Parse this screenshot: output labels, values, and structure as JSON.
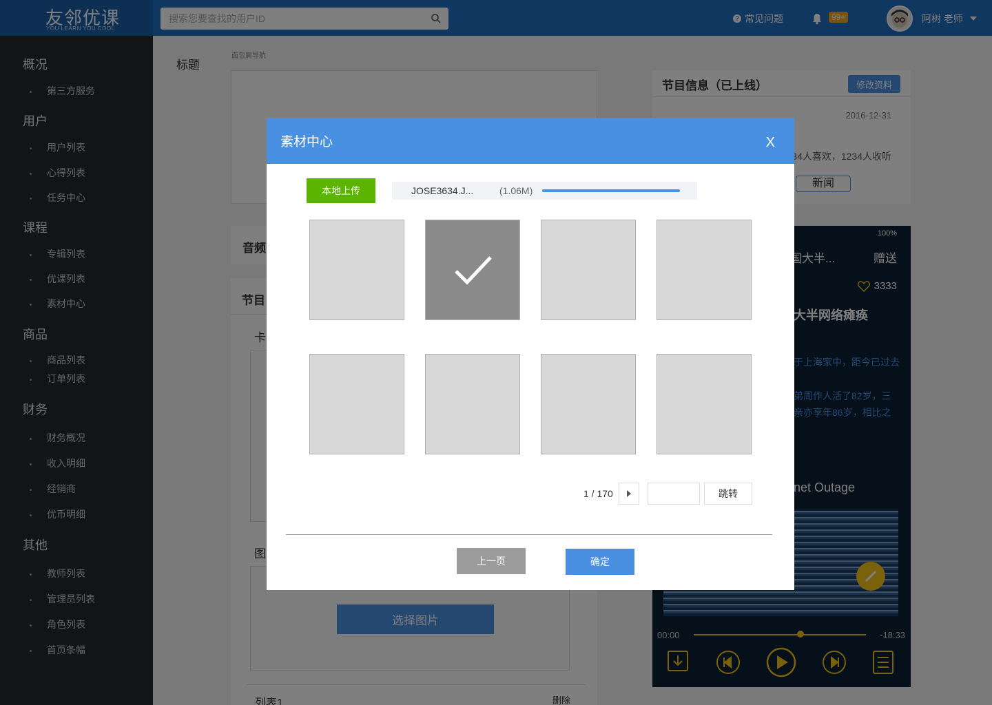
{
  "header": {
    "logo_main": "友邻优课",
    "logo_sub": "YOU LEARN YOU COOL",
    "search_placeholder": "搜索您要查找的用户ID",
    "faq": "常见问题",
    "badge": "99+",
    "user": "阿树 老师",
    "accent": "#1f6fc0"
  },
  "sidebar": {
    "sections": [
      {
        "label": "概况",
        "items": [
          "第三方服务"
        ]
      },
      {
        "label": "用户",
        "items": [
          "用户列表",
          "心得列表",
          "任务中心"
        ]
      },
      {
        "label": "课程",
        "items": [
          "专辑列表",
          "优课列表",
          "素材中心"
        ]
      },
      {
        "label": "商品",
        "items": [
          "商品列表",
          "订单列表"
        ]
      },
      {
        "label": "财务",
        "items": [
          "财务概况",
          "收入明细",
          "经销商",
          "优币明细"
        ]
      },
      {
        "label": "其他",
        "items": [
          "教师列表",
          "管理员列表",
          "角色列表",
          "首页条幅"
        ]
      }
    ]
  },
  "main": {
    "title_label": "标题",
    "breadcrumb": "面包屑导航",
    "audio_label": "音频",
    "program_label": "节目",
    "card_label": "卡",
    "picture_label": "图",
    "choose_image": "选择图片",
    "list_label": "列表1",
    "list_delete": "删除"
  },
  "info": {
    "title": "节目信息（已上线）",
    "edit": "修改资料",
    "date": "2016-12-31",
    "stats": "34人喜欢，1234人收听",
    "tag": "新闻"
  },
  "phone": {
    "battery": "100%",
    "title": "国大半...",
    "gift": "赠送",
    "likes": "3333",
    "headline": "大半网络瘫痪",
    "desc1": "于上海家中，距今已过去",
    "desc2": "弟周作人活了82岁，三",
    "desc3": "亲亦享年86岁，相比之",
    "outage": "net Outage",
    "time_start": "00:00",
    "time_end": "-18:33",
    "progress": 0.62
  },
  "modal": {
    "title": "素材中心",
    "close": "X",
    "upload_label": "本地上传",
    "file_name": "JOSE3634.J...",
    "file_size": "(1.06M)",
    "upload_progress": 1.0,
    "selected_index": 1,
    "page_info": "1 / 170",
    "jump_label": "跳转",
    "prev_label": "上一页",
    "confirm_label": "确定",
    "accent": "#4a90e2"
  }
}
